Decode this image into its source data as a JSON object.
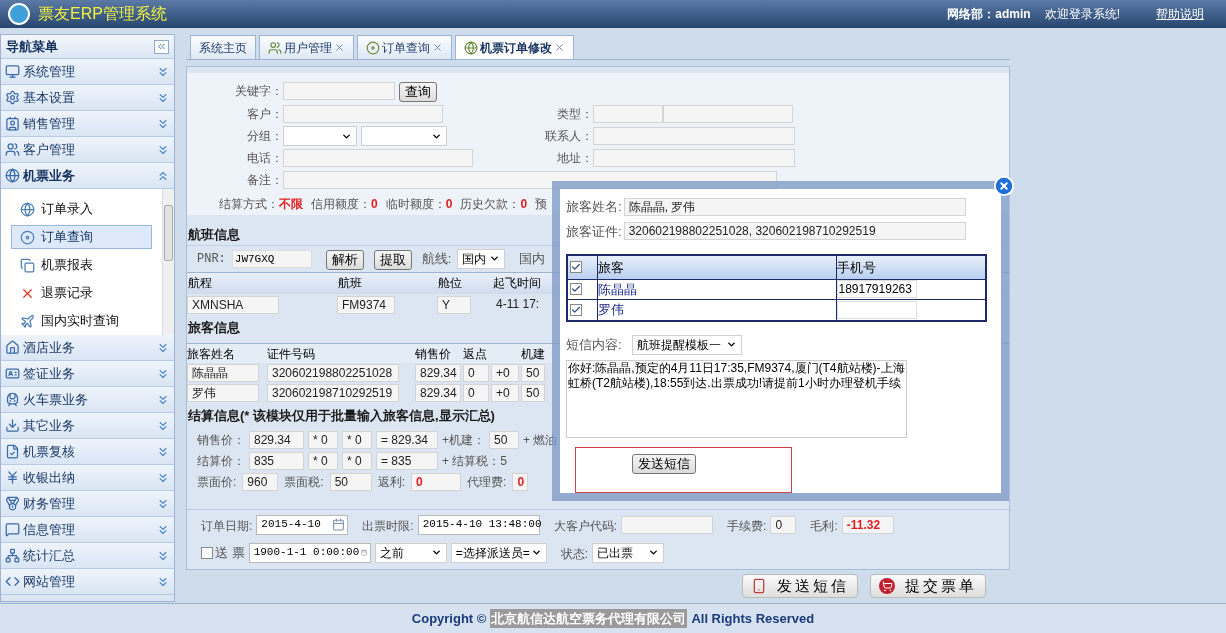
{
  "header": {
    "title": "票友ERP管理系统",
    "user": "网络部：admin",
    "welcome": "欢迎登录系统!",
    "help": "帮助说明"
  },
  "sidebar": {
    "title": "导航菜单",
    "items": [
      {
        "label": "系统管理",
        "expanded": false
      },
      {
        "label": "基本设置",
        "expanded": false
      },
      {
        "label": "销售管理",
        "expanded": false
      },
      {
        "label": "客户管理",
        "expanded": false
      },
      {
        "label": "机票业务",
        "expanded": true,
        "children": [
          {
            "label": "订单录入",
            "selected": false
          },
          {
            "label": "订单查询",
            "selected": true
          },
          {
            "label": "机票报表",
            "selected": false
          },
          {
            "label": "退票记录",
            "selected": false
          },
          {
            "label": "国内实时查询",
            "selected": false
          }
        ]
      },
      {
        "label": "酒店业务",
        "expanded": false
      },
      {
        "label": "签证业务",
        "expanded": false
      },
      {
        "label": "火车票业务",
        "expanded": false
      },
      {
        "label": "其它业务",
        "expanded": false
      },
      {
        "label": "机票复核",
        "expanded": false
      },
      {
        "label": "收银出纳",
        "expanded": false
      },
      {
        "label": "财务管理",
        "expanded": false
      },
      {
        "label": "信息管理",
        "expanded": false
      },
      {
        "label": "统计汇总",
        "expanded": false
      },
      {
        "label": "网站管理",
        "expanded": false
      }
    ]
  },
  "tabs": [
    {
      "label": "系统主页",
      "closable": false,
      "selected": false
    },
    {
      "label": "用户管理",
      "closable": true,
      "selected": false
    },
    {
      "label": "订单查询",
      "closable": true,
      "selected": false
    },
    {
      "label": "机票订单修改",
      "closable": true,
      "selected": true
    }
  ],
  "customer": {
    "keyword_label": "关键字：",
    "search_button": "查询",
    "customer_label": "客户：",
    "group_label": "分组：",
    "phone_label": "电话：",
    "note_label": "备注：",
    "type_label": "类型：",
    "contact_label": "联系人：",
    "address_label": "地址：",
    "balance": [
      {
        "label": "结算方式：",
        "value": "不限"
      },
      {
        "label": "信用额度：",
        "value": "0"
      },
      {
        "label": "临时额度：",
        "value": "0"
      },
      {
        "label": "历史欠款：",
        "value": "0"
      }
    ],
    "balance_more": "预"
  },
  "flight": {
    "title": "航班信息",
    "pnr_label": "PNR:",
    "pnr": "JW7GXQ",
    "buttons": [
      "解析",
      "提取"
    ],
    "route_label": "航线:",
    "route": "国内",
    "route_2": "国内",
    "columns": [
      "航程",
      "航班",
      "舱位",
      "起飞时间"
    ],
    "row": [
      "XMNSHA",
      "FM9374",
      "Y",
      "4-11 17:"
    ]
  },
  "passengers": {
    "title": "旅客信息",
    "columns": [
      "旅客姓名",
      "证件号码",
      "销售价",
      "返点",
      "",
      "机建"
    ],
    "rows": [
      [
        "陈晶晶",
        "320602198802251028",
        "829.34",
        "0",
        "+0",
        "50"
      ],
      [
        "罗伟",
        "320602198710292519",
        "829.34",
        "0",
        "+0",
        "50"
      ]
    ]
  },
  "settlement": {
    "title": "结算信息(* 该模块仅用于批量输入旅客信息,显示汇总)",
    "rows": [
      [
        {
          "kind": "label",
          "text": "销售价："
        },
        {
          "kind": "field",
          "text": "829.34"
        },
        {
          "kind": "field",
          "text": "* 0"
        },
        {
          "kind": "field",
          "text": "* 0"
        },
        {
          "kind": "field",
          "text": "= 829.34"
        },
        {
          "kind": "label",
          "text": "+机建："
        },
        {
          "kind": "field",
          "text": "50"
        },
        {
          "kind": "label",
          "text": "+ 燃油"
        }
      ],
      [
        {
          "kind": "label",
          "text": "结算价："
        },
        {
          "kind": "field",
          "text": "835"
        },
        {
          "kind": "field",
          "text": "* 0"
        },
        {
          "kind": "field",
          "text": "* 0"
        },
        {
          "kind": "field",
          "text": "= 835"
        },
        {
          "kind": "label",
          "text": "+ 结算税：5"
        }
      ],
      [
        {
          "kind": "label",
          "text": "票面价:"
        },
        {
          "kind": "field",
          "text": "960"
        },
        {
          "kind": "label",
          "text": "票面税:"
        },
        {
          "kind": "field",
          "text": "50"
        },
        {
          "kind": "label",
          "text": "返利:"
        },
        {
          "kind": "warn",
          "text": "0"
        },
        {
          "kind": "label",
          "text": "代理费:"
        },
        {
          "kind": "warn",
          "text": "0"
        }
      ]
    ]
  },
  "order": {
    "rows": [
      [
        {
          "kind": "label",
          "text": "订单日期:"
        },
        {
          "kind": "date",
          "text": "2015-4-10"
        },
        {
          "kind": "label",
          "text": "出票时限:"
        },
        {
          "kind": "date",
          "text": "2015-4-10 13:48:00"
        },
        {
          "kind": "label",
          "text": "大客户代码:"
        },
        {
          "kind": "field",
          "text": ""
        },
        {
          "kind": "label",
          "text": "手续费:"
        },
        {
          "kind": "field",
          "text": "0"
        },
        {
          "kind": "label",
          "text": "毛利:"
        },
        {
          "kind": "warn",
          "text": "-11.32"
        }
      ],
      [
        {
          "kind": "checkbox",
          "text": "送 票",
          "checked": false
        },
        {
          "kind": "date",
          "text": "1900-1-1 0:00:00"
        },
        {
          "kind": "select",
          "text": "之前"
        },
        {
          "kind": "select",
          "text": "=选择派送员="
        },
        {
          "kind": "label",
          "text": "状态:"
        },
        {
          "kind": "select",
          "text": "已出票"
        }
      ]
    ]
  },
  "actions": [
    "发送短信",
    "提交票单"
  ],
  "dialog": {
    "name_label": "旅客姓名:",
    "names": "陈晶晶, 罗伟",
    "id_label": "旅客证件:",
    "ids": "320602198802251028, 320602198710292519",
    "all_checked": true,
    "columns": [
      "旅客",
      "手机号"
    ],
    "rows": [
      {
        "name": "陈晶晶",
        "phone": "18917919263",
        "checked": true
      },
      {
        "name": "罗伟",
        "phone": "",
        "checked": true
      }
    ],
    "sms_label": "短信内容:",
    "template": "航班提醒模板一",
    "message": "你好:陈晶晶,预定的4月11日17:35,FM9374,厦门(T4航站楼)-上海虹桥(T2航站楼),18:55到达.出票成功!请提前1小时办理登机手续",
    "send_button": "发送短信"
  },
  "footer": {
    "prefix": "Copyright ©",
    "company": "北京航信达航空票务代理有限公司",
    "suffix": "All Rights Reserved"
  }
}
